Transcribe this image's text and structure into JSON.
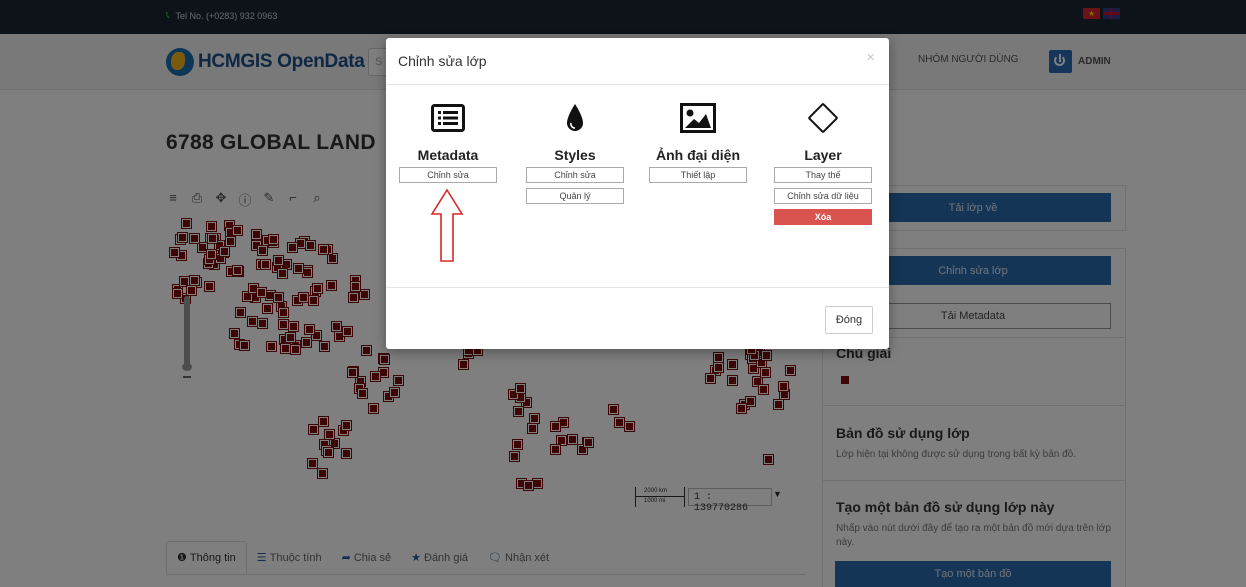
{
  "topbar": {
    "tel": "Tel No. (+0283) 932 0963"
  },
  "navbar": {
    "logo": "HCMGIS OpenData",
    "search_placeholder": "S",
    "group_link": "NHÓM NGƯỜI DÙNG",
    "admin_link": "ADMIN"
  },
  "page": {
    "title": "6788 GLOBAL LAND"
  },
  "map": {
    "scale_top": "2000 km",
    "scale_bottom": "1000 mi",
    "scale_value": "1 : 139770286"
  },
  "tabs": [
    {
      "label": "Thông tin",
      "icon": "info-icon"
    },
    {
      "label": "Thuộc tính",
      "icon": "list-icon"
    },
    {
      "label": "Chia sẻ",
      "icon": "share-icon"
    },
    {
      "label": "Đánh giá",
      "icon": "star-icon"
    },
    {
      "label": "Nhận xét",
      "icon": "comment-icon"
    }
  ],
  "sidebar": {
    "download_layer": "Tải lớp về",
    "edit_layer": "Chỉnh sửa lớp",
    "download_metadata": "Tải Metadata",
    "legend_title": "Chú giải",
    "maps_using_title": "Bản đồ sử dụng lớp",
    "maps_using_text": "Lớp hiện tại không được sử dụng trong bất kỳ bản đồ.",
    "create_map_title": "Tạo một bản đồ sử dụng lớp này",
    "create_map_text": "Nhấp vào nút dưới đây để tạo ra một bản đồ mới dựa trên lớp này.",
    "create_map_button": "Tạo một bản đồ"
  },
  "modal": {
    "title": "Chỉnh sửa lớp",
    "close_icon": "×",
    "columns": {
      "metadata": {
        "title": "Metadata",
        "icon": "list-alt-icon",
        "buttons": [
          "Chỉnh sửa"
        ]
      },
      "styles": {
        "title": "Styles",
        "icon": "tint-icon",
        "buttons": [
          "Chỉnh sửa",
          "Quản lý"
        ]
      },
      "thumbnail": {
        "title": "Ảnh đại diện",
        "icon": "picture-icon",
        "buttons": [
          "Thiết lập"
        ]
      },
      "layer": {
        "title": "Layer",
        "icon": "diamond-icon",
        "buttons": [
          "Thay thế",
          "Chỉnh sửa dữ liệu"
        ],
        "danger_button": "Xóa"
      }
    },
    "footer_close": "Đóng"
  },
  "colors": {
    "primary": "#2a6aad",
    "danger": "#d9534f",
    "points": "#7b0a0a",
    "annotation_arrow": "#d62828"
  }
}
